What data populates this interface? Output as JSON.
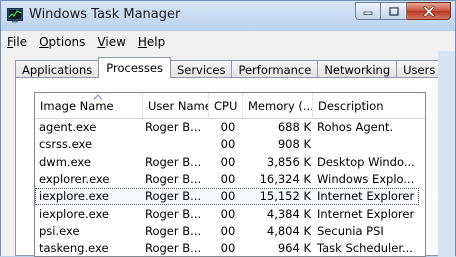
{
  "window": {
    "title": "Windows Task Manager",
    "app_icon": "task-manager-icon"
  },
  "caption_buttons": {
    "minimize_icon": "minimize-icon",
    "maximize_icon": "maximize-icon",
    "close_icon": "close-icon"
  },
  "menu": {
    "items": [
      {
        "label": "File",
        "accel": "F",
        "rest": "ile"
      },
      {
        "label": "Options",
        "accel": "O",
        "rest": "ptions"
      },
      {
        "label": "View",
        "accel": "V",
        "rest": "iew"
      },
      {
        "label": "Help",
        "accel": "H",
        "rest": "elp"
      }
    ]
  },
  "tabs": [
    "Applications",
    "Processes",
    "Services",
    "Performance",
    "Networking",
    "Users"
  ],
  "active_tab": "Processes",
  "table": {
    "columns": [
      "Image Name",
      "User Name",
      "CPU",
      "Memory (...",
      "Description"
    ],
    "sorted_column": "Image Name",
    "sort_direction": "ascending",
    "rows": [
      {
        "name": "agent.exe",
        "user": "Roger B...",
        "cpu": "00",
        "mem": "688 K",
        "desc": "Rohos Agent."
      },
      {
        "name": "csrss.exe",
        "user": "",
        "cpu": "00",
        "mem": "908 K",
        "desc": ""
      },
      {
        "name": "dwm.exe",
        "user": "Roger B...",
        "cpu": "00",
        "mem": "3,856 K",
        "desc": "Desktop Windo..."
      },
      {
        "name": "explorer.exe",
        "user": "Roger B...",
        "cpu": "00",
        "mem": "16,324 K",
        "desc": "Windows Explo..."
      },
      {
        "name": "iexplore.exe",
        "user": "Roger B...",
        "cpu": "00",
        "mem": "15,152 K",
        "desc": "Internet Explorer",
        "selected": true
      },
      {
        "name": "iexplore.exe",
        "user": "Roger B...",
        "cpu": "00",
        "mem": "4,384 K",
        "desc": "Internet Explorer"
      },
      {
        "name": "psi.exe",
        "user": "Roger B...",
        "cpu": "00",
        "mem": "4,804 K",
        "desc": "Secunia PSI"
      },
      {
        "name": "taskeng.exe",
        "user": "Roger B...",
        "cpu": "00",
        "mem": "964 K",
        "desc": "Task Scheduler..."
      }
    ]
  },
  "colors": {
    "close_red": "#c7503a",
    "title_bg": "#bcd2ec",
    "selection_border": "#5a5a5a"
  }
}
